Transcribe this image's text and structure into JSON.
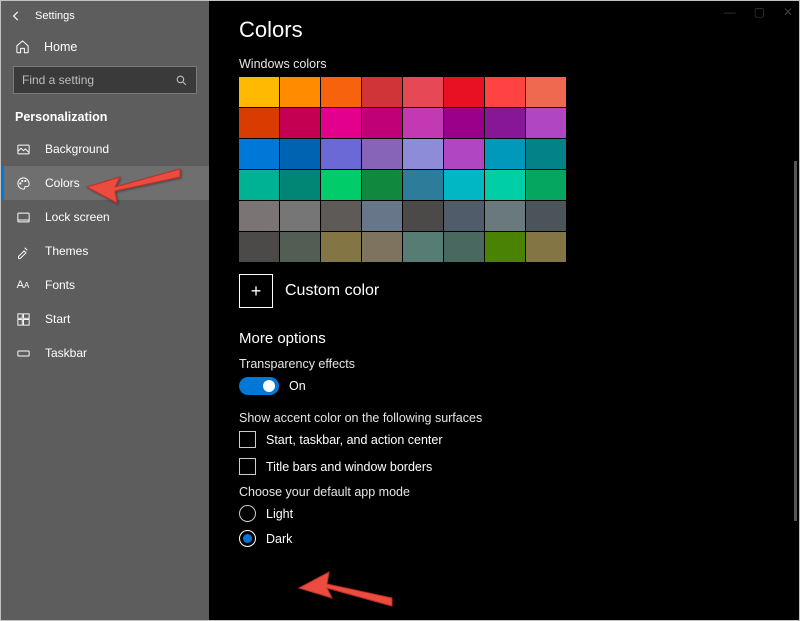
{
  "window": {
    "title": "Settings",
    "controls": {
      "min": "—",
      "max": "▢",
      "close": "✕"
    }
  },
  "sidebar": {
    "home": "Home",
    "search_placeholder": "Find a setting",
    "section": "Personalization",
    "items": [
      {
        "icon": "picture-icon",
        "label": "Background"
      },
      {
        "icon": "palette-icon",
        "label": "Colors",
        "active": true
      },
      {
        "icon": "lock-icon",
        "label": "Lock screen"
      },
      {
        "icon": "theme-icon",
        "label": "Themes"
      },
      {
        "icon": "font-icon",
        "label": "Fonts"
      },
      {
        "icon": "start-icon",
        "label": "Start"
      },
      {
        "icon": "taskbar-icon",
        "label": "Taskbar"
      }
    ]
  },
  "main": {
    "heading": "Colors",
    "palette_label": "Windows colors",
    "palette": [
      [
        "#ffb900",
        "#ff8c00",
        "#f7630c",
        "#d13438",
        "#e74856",
        "#e81123",
        "#ff4343",
        "#ef6950"
      ],
      [
        "#da3b01",
        "#c30052",
        "#e3008c",
        "#bf0077",
        "#c239b3",
        "#9a0089",
        "#881798",
        "#b146c2"
      ],
      [
        "#0078d7",
        "#0063b1",
        "#6b69d6",
        "#8764b8",
        "#8e8cd8",
        "#b146c2",
        "#0099bc",
        "#038387"
      ],
      [
        "#00b294",
        "#018574",
        "#00cc6a",
        "#10893e",
        "#2d7d9a",
        "#00b7c3",
        "#00cea6",
        "#05a660"
      ],
      [
        "#7a7574",
        "#767676",
        "#5d5a58",
        "#68768a",
        "#4c4a48",
        "#515c6b",
        "#69797e",
        "#4a5459"
      ],
      [
        "#4c4a48",
        "#525e54",
        "#847545",
        "#7e735f",
        "#567c73",
        "#486860",
        "#498205",
        "#847545"
      ]
    ],
    "custom_color": "Custom color",
    "more_options": "More options",
    "transparency": {
      "label": "Transparency effects",
      "value": "On"
    },
    "accent_surfaces": {
      "label": "Show accent color on the following surfaces",
      "opt1": "Start, taskbar, and action center",
      "opt2": "Title bars and window borders"
    },
    "app_mode": {
      "label": "Choose your default app mode",
      "light": "Light",
      "dark": "Dark",
      "selected": "dark"
    }
  }
}
